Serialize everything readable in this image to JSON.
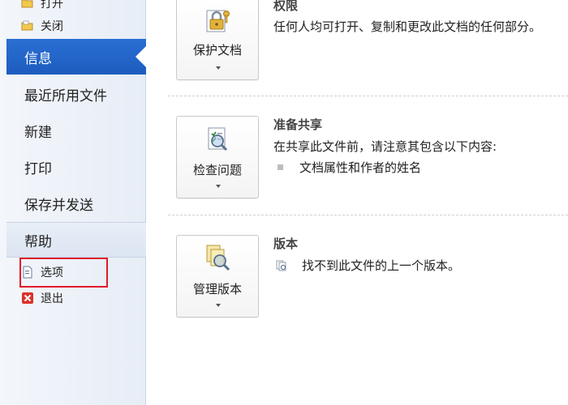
{
  "sidebar": {
    "open_label": "打开",
    "close_label": "关闭",
    "nav": [
      "信息",
      "最近所用文件",
      "新建",
      "打印",
      "保存并发送",
      "帮助"
    ],
    "options_label": "选项",
    "exit_label": "退出"
  },
  "sections": {
    "permissions": {
      "title": "权限",
      "description": "任何人均可打开、复制和更改此文档的任何部分。",
      "button_label": "保护文档"
    },
    "share": {
      "title": "准备共享",
      "description": "在共享此文件前，请注意其包含以下内容:",
      "bullet": "文档属性和作者的姓名",
      "button_label": "检查问题"
    },
    "versions": {
      "title": "版本",
      "description": "找不到此文件的上一个版本。",
      "button_label": "管理版本"
    }
  },
  "colors": {
    "active_nav": "#1d5cbf",
    "highlight_border": "#e21b2a"
  }
}
